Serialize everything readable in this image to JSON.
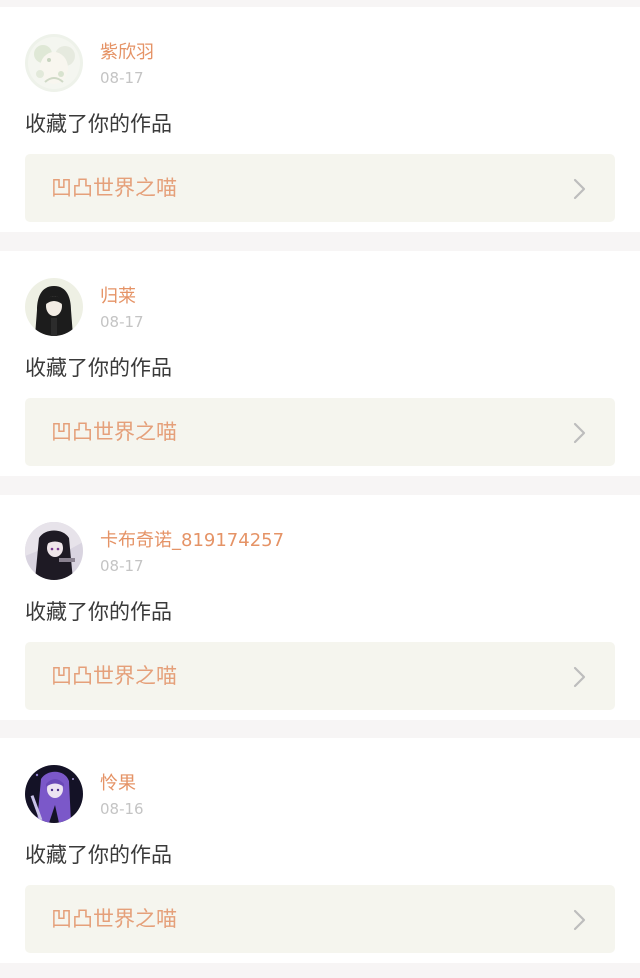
{
  "feed": {
    "items": [
      {
        "username": "紫欣羽",
        "date": "08-17",
        "action": "收藏了你的作品",
        "work_title": "凹凸世界之喵",
        "avatar_icon": "avatar-pale-anime-girl-icon"
      },
      {
        "username": "归莱",
        "date": "08-17",
        "action": "收藏了你的作品",
        "work_title": "凹凸世界之喵",
        "avatar_icon": "avatar-hooded-figure-icon"
      },
      {
        "username": "卡布奇诺_819174257",
        "date": "08-17",
        "action": "收藏了你的作品",
        "work_title": "凹凸世界之喵",
        "avatar_icon": "avatar-dark-anime-character-icon"
      },
      {
        "username": "怜果",
        "date": "08-16",
        "action": "收藏了你的作品",
        "work_title": "凹凸世界之喵",
        "avatar_icon": "avatar-purple-hair-anime-icon"
      }
    ],
    "colors": {
      "username": "#e59366",
      "date": "#c4c4c4",
      "action_text": "#3a3a3a",
      "work_title": "#e5a07a",
      "work_box": "#f5f5ee",
      "background": "#f7f5f5"
    }
  }
}
